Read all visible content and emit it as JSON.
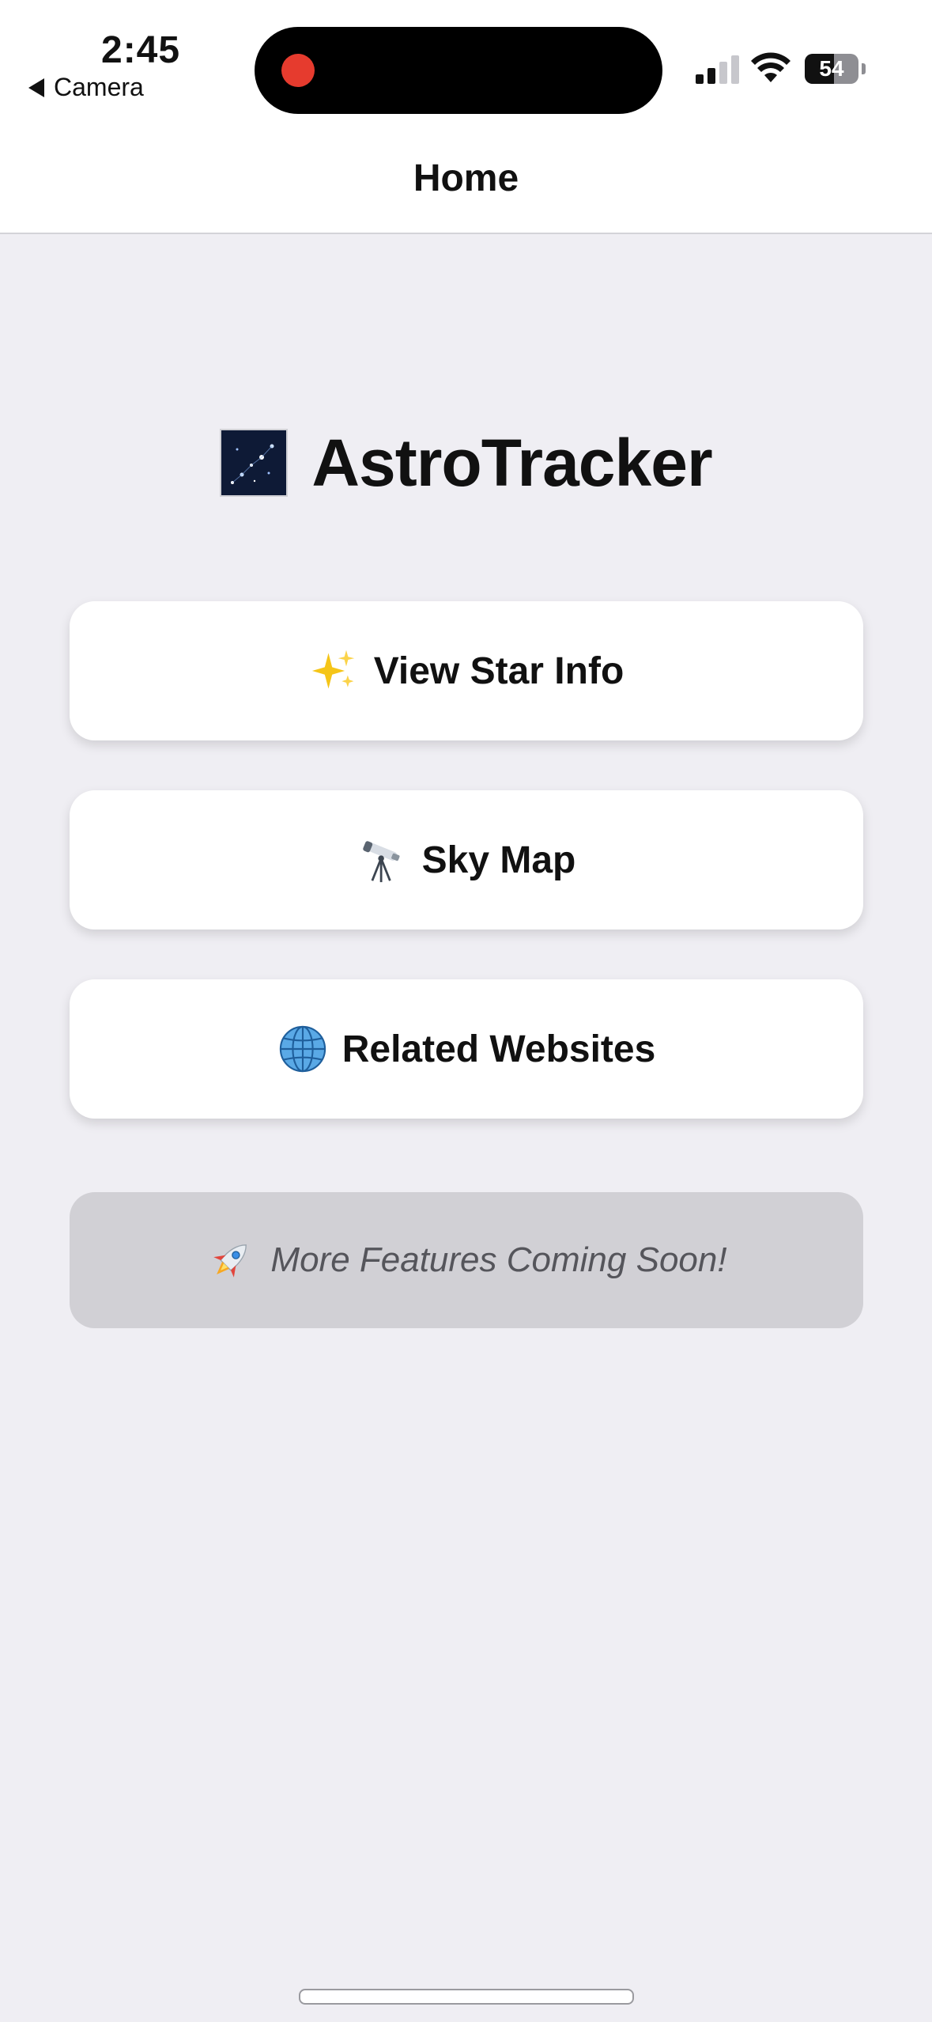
{
  "status_bar": {
    "time": "2:45",
    "back_label": "Camera",
    "battery": "54",
    "battery_level": 0.54,
    "recording_color": "#e63b2e",
    "icons": [
      "signal-icon",
      "wifi-icon",
      "battery-icon"
    ]
  },
  "nav": {
    "title": "Home"
  },
  "app": {
    "title": "AstroTracker",
    "logo_icon": "night-sky-icon"
  },
  "menu": {
    "view_star_info": {
      "label": "View Star Info",
      "icon": "sparkles-icon"
    },
    "sky_map": {
      "label": "Sky Map",
      "icon": "telescope-icon"
    },
    "related_websites": {
      "label": "Related Websites",
      "icon": "globe-icon"
    }
  },
  "coming_soon": {
    "label": "More Features Coming Soon!",
    "icon": "rocket-icon"
  },
  "colors": {
    "background": "#efeef3",
    "card": "#ffffff",
    "disabled_card": "#d1d0d5",
    "text": "#111111",
    "muted_text": "#55555b"
  }
}
